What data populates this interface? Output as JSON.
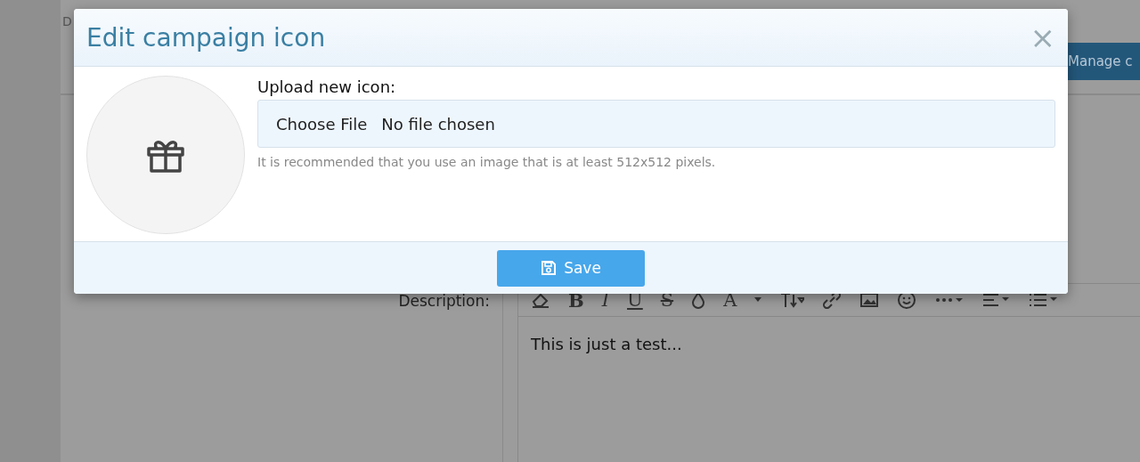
{
  "page": {
    "breadcrumb": "D",
    "manage_button": "Manage c",
    "description_label": "Description:",
    "toolbar_glyphs": [
      "B",
      "I",
      "U",
      "S",
      "A"
    ],
    "editor_text": "This is just a test..."
  },
  "dialog": {
    "title": "Edit campaign icon",
    "close": "×",
    "upload_label": "Upload new icon:",
    "choose_button": "Choose File",
    "file_status": "No file chosen",
    "hint": "It is recommended that you use an image that is at least 512x512 pixels.",
    "save_button": "Save"
  }
}
